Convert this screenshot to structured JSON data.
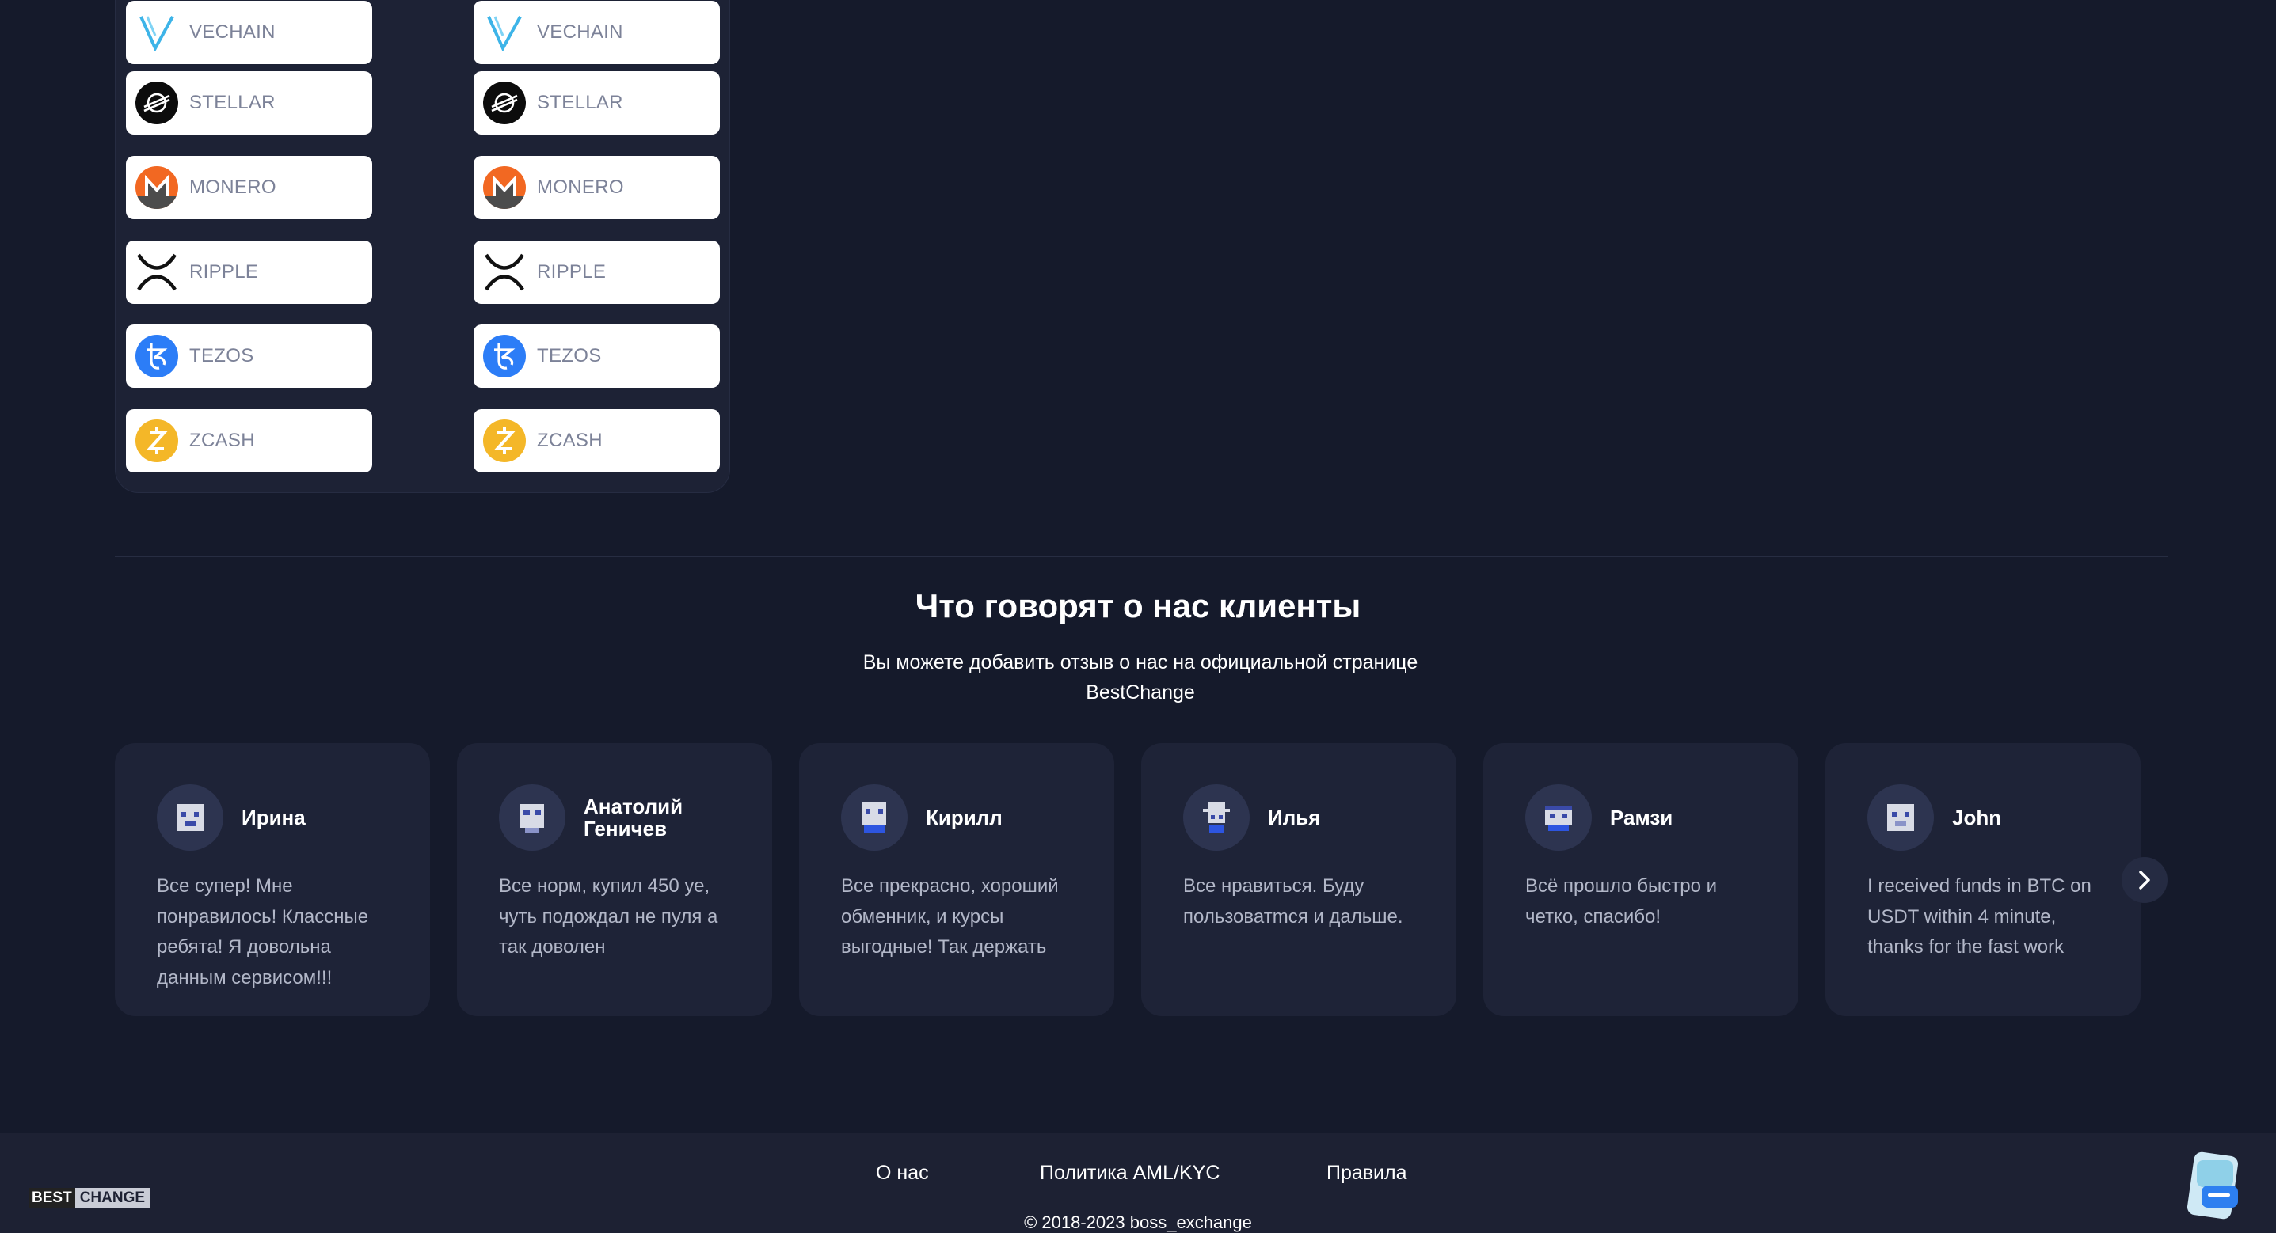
{
  "coins_left": [
    {
      "name": "VECHAIN",
      "icon": "vechain-icon"
    },
    {
      "name": "STELLAR",
      "icon": "stellar-icon"
    },
    {
      "name": "MONERO",
      "icon": "monero-icon"
    },
    {
      "name": "RIPPLE",
      "icon": "ripple-icon"
    },
    {
      "name": "TEZOS",
      "icon": "tezos-icon"
    },
    {
      "name": "ZCASH",
      "icon": "zcash-icon"
    }
  ],
  "coins_right": [
    {
      "name": "VECHAIN",
      "icon": "vechain-icon"
    },
    {
      "name": "STELLAR",
      "icon": "stellar-icon"
    },
    {
      "name": "MONERO",
      "icon": "monero-icon"
    },
    {
      "name": "RIPPLE",
      "icon": "ripple-icon"
    },
    {
      "name": "TEZOS",
      "icon": "tezos-icon"
    },
    {
      "name": "ZCASH",
      "icon": "zcash-icon"
    }
  ],
  "reviews": {
    "title": "Что говорят о нас клиенты",
    "subtitle": "Вы можете добавить отзыв о нас на официальной странице BestChange",
    "items": [
      {
        "author": "Ирина",
        "text": "Все супер! Мне понравилось! Классные ребята! Я довольна данным сервисом!!!"
      },
      {
        "author": "Анатолий Геничев",
        "text": "Все норм, купил 450 уе, чуть подождал не пуля а так доволен"
      },
      {
        "author": "Кирилл",
        "text": "Все прекрасно, хороший обменник, и курсы выгодные! Так держать"
      },
      {
        "author": "Илья",
        "text": "Все нравиться. Буду пользоватmся и дальше."
      },
      {
        "author": "Рамзи",
        "text": "Всё прошло быстро и четко, спасибо!"
      },
      {
        "author": "John",
        "text": "I received funds in BTC on USDT within 4 minute, thanks for the fast work"
      }
    ]
  },
  "footer": {
    "links": [
      "О нас",
      "Политика AML/KYC",
      "Правила"
    ],
    "copyright": "© 2018-2023 boss_exchange",
    "logo_best": "BEST",
    "logo_change": "CHANGE"
  },
  "colors": {
    "background": "#151a2b",
    "card": "#1e2337",
    "footer": "#1d2133"
  }
}
